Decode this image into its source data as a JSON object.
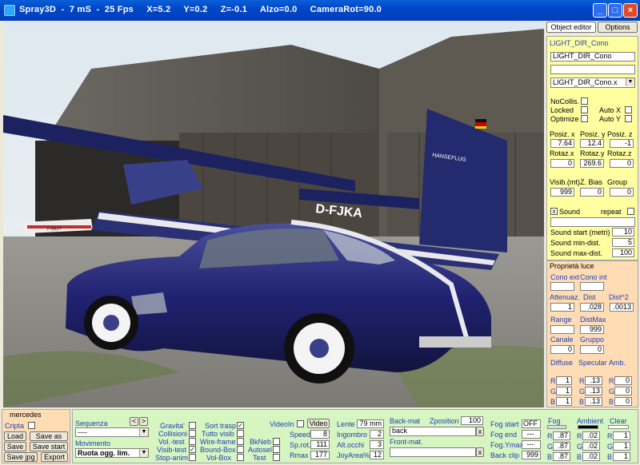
{
  "window": {
    "title": "Spray3D  -  7 mS  -  25 Fps     X=5.2     Y=0.2     Z=-0.1     Alzo=0.0     CameraRot=90.0"
  },
  "scene": {
    "plane_registration": "D-FJKA",
    "plane_tail_text": "HANSEFLUG",
    "small_plane_reg": "F-BADY",
    "colors": {
      "car": "#1f2270",
      "plane": "#242a6e",
      "hangar": "#5e5a52",
      "ground": "#8d8b86",
      "sky": "#dfe8f0"
    }
  },
  "tabs": {
    "object_editor": "Object editor",
    "options": "Options"
  },
  "object": {
    "section_title": "LIGHT_DIR_Cono",
    "name_value": "LIGHT_DIR_Cono",
    "name2_value": "",
    "file_select": "LIGHT_DIR_Cono.x",
    "nocollis": "NoCollis.",
    "locked": "Locked",
    "optimize": "Optimize",
    "autox": "Auto X",
    "autoy": "Auto Y",
    "posx_label": "Posiz. x",
    "posy_label": "Posiz. y",
    "posz_label": "Posiz. z",
    "posx": "7.64",
    "posy": "12.4",
    "posz": "-1",
    "rotx_label": "Rotaz.x",
    "roty_label": "Rotaz.y",
    "rotz_label": "Rotaz.z",
    "rotx": "0",
    "roty": "269.6",
    "rotz": "0",
    "visib_label": "Visib.(mt)",
    "zbias_label": "Z. Bias",
    "group_label": "Group",
    "visib": "999",
    "zbias": "0",
    "group": "0",
    "sound_label": "Sound",
    "repeat_label": "repeat",
    "sound_value": "",
    "sound_start_label": "Sound start (metri)",
    "sound_start": "10",
    "sound_min_label": "Sound min-dist.",
    "sound_min": "5",
    "sound_max_label": "Sound max-dist.",
    "sound_max": "100"
  },
  "light": {
    "title": "Proprietà luce",
    "cono_ext": "Cono ext",
    "cono_int": "Cono int",
    "cono_ext_v": "",
    "cono_int_v": "",
    "att_label": "Attenuaz.",
    "dist_label": "Dist",
    "dist2_label": "Dist^2",
    "att": "1",
    "dist": ".028",
    "dist2": ".0013",
    "range_label": "Range",
    "distmax_label": "DistMax",
    "range": "",
    "distmax": "999",
    "canale_label": "Canale",
    "gruppo_label": "Gruppo",
    "canale": "0",
    "gruppo": "0",
    "diffuse_label": "Diffuse",
    "specular_label": "Specular",
    "amb_label": "Amb.",
    "diffuse": [
      "1",
      "1",
      "1"
    ],
    "specular": [
      ".13",
      ".13",
      ".13"
    ],
    "amb": [
      "0",
      "0",
      "0"
    ],
    "rgb": [
      "R",
      "G",
      "B"
    ]
  },
  "mercedes": {
    "title": "mercedes",
    "cripta": "Cripta",
    "load": "Load",
    "saveas": "Save as",
    "save": "Save",
    "savestart": "Save start",
    "savejpg": "Save jpg",
    "export": "Export"
  },
  "seq": {
    "sequenza": "Sequenza",
    "seq_value": "----",
    "movimento": "Movimento",
    "mov_value": "Ruota ogg. lim."
  },
  "flags": {
    "gravita": "Gravita'",
    "collisioni": "Collisioni",
    "voltest": "Vol.-test",
    "visibtest": "Visib-test",
    "stopanim": "Stop-anim",
    "sorttrasp": "Sort trasp",
    "tuttovisib": "Tutto visib",
    "wireframe": "Wire-frame",
    "boundbox": "Bound-Box",
    "volbox": "Vol-Box",
    "bkneb": "BkNeb",
    "autosel": "Autosel",
    "test": "Test"
  },
  "video": {
    "videoin": "VideoIn",
    "video_btn": "Video",
    "speed_label": "Speed",
    "speed": "8",
    "sprot_label": "Sp.rot.",
    "sprot": "111",
    "rmax_label": "Rmax",
    "rmax": "177"
  },
  "lens": {
    "lente_label": "Lente",
    "lente": "79 mm",
    "ingombro_label": "Ingombro",
    "ingombro": "2",
    "altocchi_label": "Alt.occhi",
    "altocchi": "3",
    "joyarea_label": "JoyArea%",
    "joyarea": "12"
  },
  "mat": {
    "backmat_label": "Back-mat",
    "zpos_label": "Zposition",
    "zpos": "100",
    "back_value": "back",
    "frontmat_label": "Front-mat.",
    "front_value": ""
  },
  "fog": {
    "fogstart": "Fog start",
    "fogstart_v": "OFF",
    "fogend": "Fog end",
    "fogend_v": "---",
    "fogymax": "Fog.Ymax",
    "fogymax_v": "---",
    "backclip": "Back clip",
    "backclip_v": "999"
  },
  "colors": {
    "fog_label": "Fog",
    "ambient_label": "Ambient",
    "clear_label": "Clear",
    "fog": [
      ".87",
      ".87",
      ".87"
    ],
    "ambient": [
      ".02",
      ".02",
      ".02"
    ],
    "clear": [
      "1",
      "1",
      "1"
    ]
  }
}
